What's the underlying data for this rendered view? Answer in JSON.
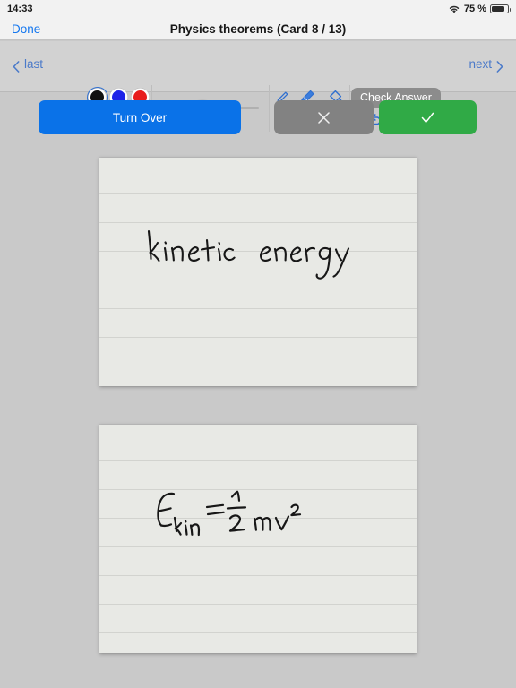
{
  "status_bar": {
    "time": "14:33",
    "wifi_icon": "wifi-icon",
    "battery_percent": "75 %",
    "battery_icon": "battery-icon"
  },
  "nav_bar": {
    "done_label": "Done",
    "title": "Physics theorems (Card 8 / 13)"
  },
  "toolbar": {
    "prev_label": "last",
    "prev_icon": "chevron-left-icon",
    "next_label": "next",
    "next_icon": "chevron-right-icon",
    "colors": [
      {
        "name": "black",
        "hex": "#111111",
        "selected": true
      },
      {
        "name": "blue",
        "hex": "#1e23e8",
        "selected": false
      },
      {
        "name": "red",
        "hex": "#e81d1d",
        "selected": false
      },
      {
        "name": "gray",
        "hex": "#878787",
        "selected": false
      },
      {
        "name": "green",
        "hex": "#20dd20",
        "selected": false
      },
      {
        "name": "orange",
        "hex": "#ef9212",
        "selected": false
      }
    ],
    "stroke_slider": {
      "icon": "scribble-icon",
      "value_percent": 22,
      "fill_color": "#1a6fe0",
      "track_color": "#b0b0b0"
    },
    "tools": [
      {
        "name": "pen-icon",
        "active": true
      },
      {
        "name": "eraser-icon",
        "active": true
      },
      {
        "name": "compass-icon",
        "active": false
      },
      {
        "name": "lasso-select-icon",
        "active": true
      },
      {
        "name": "paint-bucket-icon",
        "active": true
      },
      {
        "name": "line-tool-icon",
        "active": false
      }
    ],
    "check_answer_label": "Check Answer",
    "undo_icon": "undo-icon",
    "redo_icon": "redo-icon",
    "undo_enabled": true,
    "redo_enabled": false
  },
  "actions": {
    "turn_over_label": "Turn Over",
    "turn_over_color": "#0a72e8",
    "wrong_icon": "cross-icon",
    "wrong_color": "#828282",
    "correct_icon": "check-icon",
    "correct_color": "#30aa46"
  },
  "cards": {
    "paper_color": "#e8e9e5",
    "rule_color": "#d2d3cf",
    "line_count": 8,
    "front": {
      "label": "question-card",
      "handwriting_text": "kinetic  energy"
    },
    "back": {
      "label": "answer-card",
      "handwriting_text": "E_kin = 1/2 mv²"
    }
  }
}
